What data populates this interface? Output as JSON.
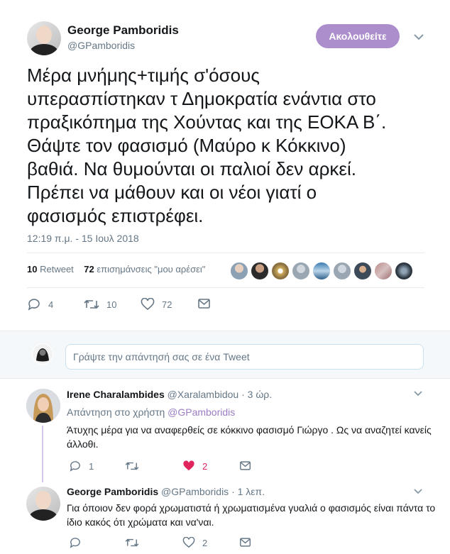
{
  "main_tweet": {
    "author_name": "George Pamboridis",
    "author_handle": "@GPamboridis",
    "follow_label": "Ακολουθείτε",
    "text_lines": [
      "Μέρα μνήμης+τιμής σ'όσους",
      "υπερασπίστηκαν τ Δημοκρατία ενάντια στο",
      "πραξικόπημα της Χούντας και της ΕΟΚΑ Β΄.",
      "Θάψτε τον φασισμό (Μαύρο κ Κόκκινο)",
      "βαθιά. Να θυμούνται οι παλιοί δεν αρκεί.",
      "Πρέπει να μάθουν και οι νέοι γιατί ο",
      "φασισμός επιστρέφει."
    ],
    "timestamp": "12:19 π.μ. - 15 Ιουλ 2018",
    "retweet_count": "10",
    "retweet_label": "Retweet",
    "likes_count": "72",
    "likes_label": "επισημάνσεις \"μου αρέσει\"",
    "actions": {
      "reply_count": "4",
      "retweet_count": "10",
      "like_count": "72"
    }
  },
  "compose": {
    "placeholder": "Γράψτε την απάντησή σας σε ένα Tweet"
  },
  "replies": [
    {
      "author_name": "Irene Charalambides",
      "author_handle": "@Xaralambidou",
      "time": "· 3 ώρ.",
      "replying_prefix": "Απάντηση στο χρήστη",
      "replying_to": "@GPamboridis",
      "text": "Άτυχης μέρα για να αναφερθείς σε κόκκινο φασισμό Γιώργο . Ως να αναζητεί κανείς άλλοθι.",
      "reply_count": "1",
      "retweet_count": "",
      "like_count": "2",
      "liked": true
    },
    {
      "author_name": "George Pamboridis",
      "author_handle": "@GPamboridis",
      "time": "· 1 λεπ.",
      "text": "Για όποιον δεν φορά χρωματιστά ή χρωματισμένα γυαλιά ο φασισμός είναι πάντα το ίδιο κακός ότι χρώματα και να'ναι.",
      "reply_count": "",
      "retweet_count": "",
      "like_count": "2",
      "liked": false
    }
  ],
  "colors": {
    "follow_button": "#ad8ecd",
    "link": "#9b7cc4",
    "like_active": "#e0245e",
    "muted": "#657786"
  }
}
